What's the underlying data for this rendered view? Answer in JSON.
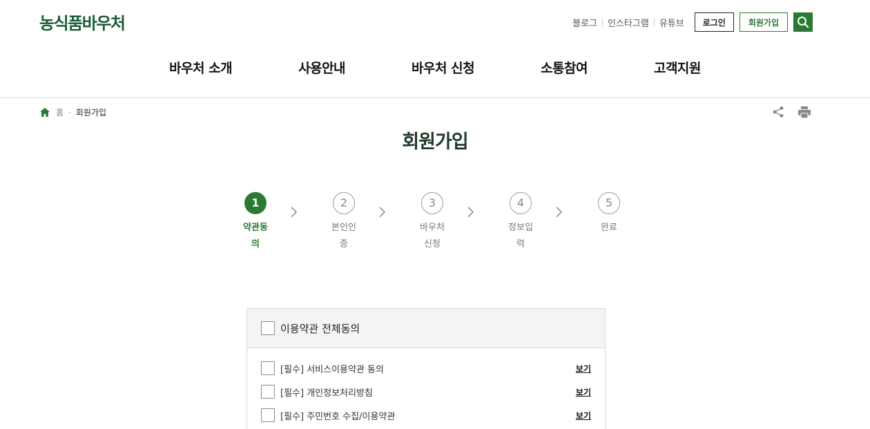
{
  "header": {
    "logo": "농식품바우처",
    "util_links": [
      "블로그",
      "인스타그램",
      "유튜브"
    ],
    "login_label": "로그인",
    "join_label": "회원가입",
    "search_icon": "search-icon"
  },
  "gnb": [
    "바우처 소개",
    "사용안내",
    "바우처 신청",
    "소통참여",
    "고객지원"
  ],
  "breadcrumb": {
    "home": "홈",
    "current": "회원가입"
  },
  "page_title": "회원가입",
  "steps": [
    {
      "num": "1",
      "label": "약관동의",
      "active": true
    },
    {
      "num": "2",
      "label": "본인인증",
      "active": false
    },
    {
      "num": "3",
      "label": "바우처신청",
      "active": false
    },
    {
      "num": "4",
      "label": "정보입력",
      "active": false
    },
    {
      "num": "5",
      "label": "완료",
      "active": false
    }
  ],
  "terms": {
    "all_label": "이용약관 전체동의",
    "items": [
      {
        "label": "[필수] 서비스이용약관 동의",
        "view": "보기"
      },
      {
        "label": "[필수] 개인정보처리방침",
        "view": "보기"
      },
      {
        "label": "[필수] 주민번호 수집/이용약관",
        "view": "보기"
      }
    ]
  },
  "colors": {
    "brand": "#2b7a33",
    "logo": "#1a5c33",
    "title": "#1f3a2a"
  }
}
